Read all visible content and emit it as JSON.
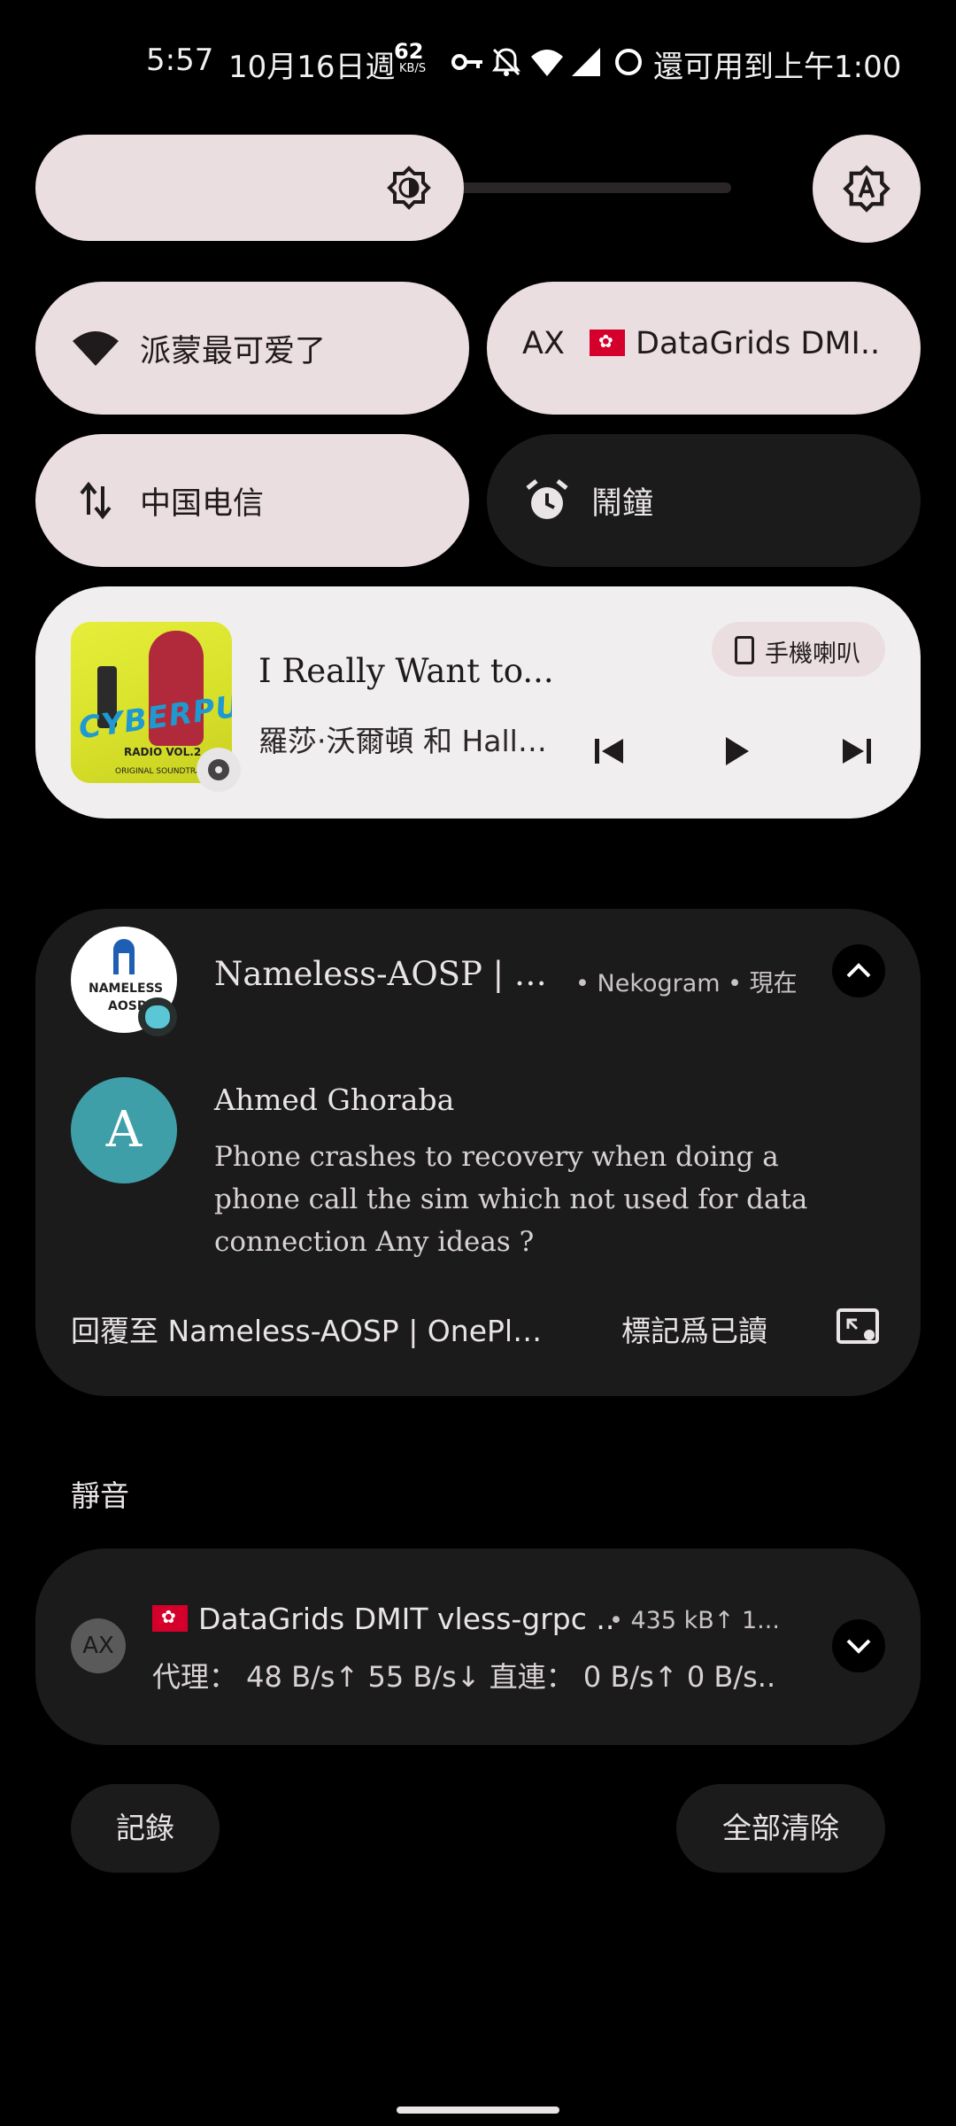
{
  "status_bar": {
    "time": "5:57",
    "date": "10月16日週",
    "net_speed_value": "62",
    "net_speed_unit": "KB/S",
    "until_text": "還可用到上午1:00",
    "icons": [
      "vpn-key-icon",
      "notifications-off-icon",
      "wifi-icon",
      "cellular-signal-icon",
      "battery-ring-icon"
    ]
  },
  "brightness": {
    "auto_icon": "brightness-auto-icon",
    "icon": "brightness-icon"
  },
  "tiles": [
    {
      "label": "派蒙最可爱了",
      "icon": "wifi-icon",
      "state": "on"
    },
    {
      "prefix": "AX",
      "label": "DataGrids DMI..",
      "icon": "hk-flag",
      "state": "on"
    },
    {
      "label": "中国电信",
      "icon": "mobile-data-icon",
      "state": "on"
    },
    {
      "label": "鬧鐘",
      "icon": "alarm-icon",
      "state": "off"
    }
  ],
  "media": {
    "song": "I Really Want to...",
    "artist": "羅莎·沃爾頓 和 Halli...",
    "output_label": "手機喇叭",
    "art_title": "CYBERPUNK",
    "art_sub1": "RADIO VOL.2",
    "art_sub2": "ORIGINAL SOUNDTRACK"
  },
  "conversation": {
    "title": "Nameless-AOSP | On...",
    "meta": "• Nekogram • 現在",
    "app_icon_text1": "NAMELESS",
    "app_icon_text2": "AOSP",
    "avatar_letter": "A",
    "sender": "Ahmed Ghoraba",
    "message": "Phone crashes to recovery when doing a phone call the sim which not used for data connection Any ideas ?",
    "action_reply": "回覆至 Nameless-AOSP | OnePlus...",
    "action_read": "標記爲已讀"
  },
  "silent_section": {
    "label": "靜音"
  },
  "vpn": {
    "icon_text": "AX",
    "title": "DataGrids DMIT vless-grpc ..",
    "meta": "• 435 kB↑ 1...",
    "line": "代理： 48 B/s↑ 55 B/s↓  直連： 0 B/s↑ 0 B/s.."
  },
  "buttons": {
    "history": "記錄",
    "clear_all": "全部清除"
  },
  "colors": {
    "tile_on": "#ebdee0",
    "tile_off": "#1c1b1c",
    "avatar": "#3f9fa8",
    "flag": "#d4002b"
  }
}
